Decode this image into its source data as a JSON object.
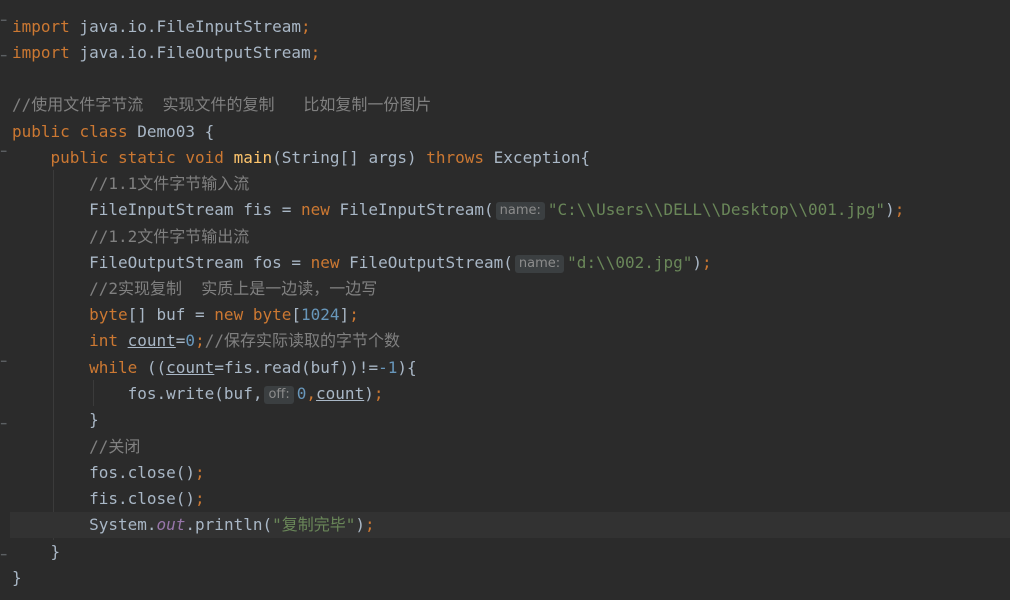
{
  "code": {
    "import1_kw": "import",
    "import1_rest": " java.io.FileInputStream",
    "import2_kw": "import",
    "import2_rest": " java.io.FileOutputStream",
    "semi": ";",
    "comment_desc": "//使用文件字节流  实现文件的复制   比如复制一份图片",
    "public": "public",
    "class": "class",
    "class_name": " Demo03 {",
    "static": "static",
    "void": "void",
    "main": "main",
    "main_params": "(String[] args) ",
    "throws": "throws",
    "exception": " Exception{",
    "comment_1_1": "//1.1文件字节输入流",
    "fis_decl": "FileInputStream fis = ",
    "new": "new",
    "fis_ctor": " FileInputStream(",
    "hint_name": "name:",
    "fis_path": "\"C:\\\\Users\\\\DELL\\\\Desktop\\\\001.jpg\"",
    "close_paren_semi": ");",
    "comment_1_2": "//1.2文件字节输出流",
    "fos_decl": "FileOutputStream fos = ",
    "fos_ctor": " FileOutputStream(",
    "fos_path": "\"d:\\\\002.jpg\"",
    "comment_2": "//2实现复制  实质上是一边读，一边写",
    "byte": "byte",
    "buf_decl": "[] buf = ",
    "buf_open": "[",
    "buf_size": "1024",
    "buf_close": "]",
    "int": "int",
    "count": "count",
    "assign_eq": "=",
    "zero": "0",
    "comment_count": "//保存实际读取的字节个数",
    "while": "while",
    "while_open": " ((",
    "read_call": "=fis.read(buf))!=",
    "minus_one": "-1",
    "while_close": "){",
    "write_call": "fos.write(buf,",
    "hint_off": "off:",
    "comma": ",",
    "close_brace": "}",
    "comment_close": "//关闭",
    "fos_close": "fos.close()",
    "fis_close": "fis.close()",
    "system": "System.",
    "out": "out",
    "println": ".println(",
    "done_str": "\"复制完毕\"",
    "method_end": "}",
    "class_end": "}"
  }
}
